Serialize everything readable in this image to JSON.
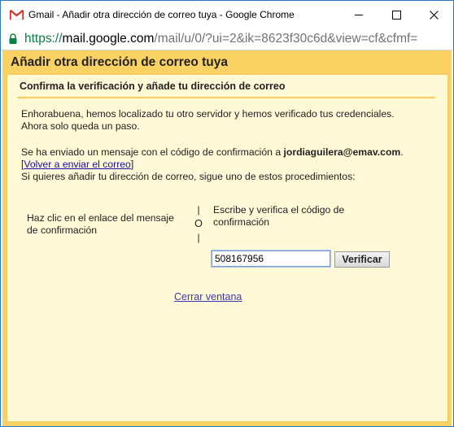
{
  "window": {
    "title": "Gmail - Añadir otra dirección de correo tuya - Google Chrome",
    "minimize_icon": "minimize-icon",
    "maximize_icon": "maximize-icon",
    "close_icon": "close-icon",
    "app_icon": "gmail-icon"
  },
  "address_bar": {
    "lock_icon": "lock-icon",
    "scheme": "https://",
    "host": "mail.google.com",
    "path": "/mail/u/0/?ui=2&ik=8623f30c6d&view=cf&cfmf="
  },
  "dialog": {
    "header": "Añadir otra dirección de correo tuya",
    "subheader": "Confirma la verificación y añade tu dirección de correo",
    "congrats_line1": "Enhorabuena, hemos localizado tu otro servidor y hemos verificado tus credenciales.",
    "congrats_line2": "Ahora solo queda un paso.",
    "sent_prefix": "Se ha enviado un mensaje con el código de confirmación a ",
    "email": "jordiaguilera@emav.com",
    "sent_suffix": ".",
    "resend_open": "[",
    "resend_link": "Volver a enviar el correo",
    "resend_close": "]",
    "procedures": "Si quieres añadir tu dirección de correo, sigue uno de estos procedimientos:",
    "option_link_line1": "Haz clic en el enlace del mensaje",
    "option_link_line2": "de confirmación",
    "or_top": "|",
    "or_mid": "O",
    "or_bottom": "|",
    "option_code_line1": "Escribe y verifica el código de",
    "option_code_line2": "confirmación",
    "code_value": "508167956",
    "verify_button": "Verificar",
    "close_window": "Cerrar ventana"
  },
  "colors": {
    "header_yellow": "#fad163",
    "inner_background": "#fff9d7",
    "link_blue": "#1a0dab",
    "url_green": "#0b8043"
  }
}
